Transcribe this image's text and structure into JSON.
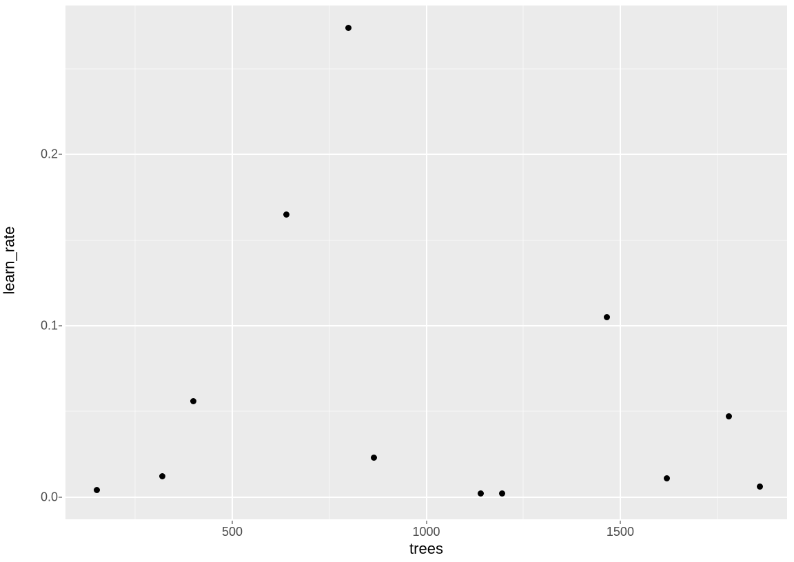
{
  "chart_data": {
    "type": "scatter",
    "xlabel": "trees",
    "ylabel": "learn_rate",
    "xlim": [
      70,
      1930
    ],
    "ylim": [
      -0.013,
      0.287
    ],
    "x_ticks": [
      500,
      1000,
      1500
    ],
    "y_ticks": [
      0.0,
      0.1,
      0.2
    ],
    "y_tick_labels": [
      "0.0",
      "0.1",
      "0.2"
    ],
    "x_minor": [
      250,
      750,
      1250,
      1750
    ],
    "y_minor": [
      0.05,
      0.15,
      0.25
    ],
    "series": [
      {
        "name": "points",
        "x": [
          150,
          320,
          400,
          640,
          800,
          865,
          1140,
          1195,
          1465,
          1620,
          1780,
          1860
        ],
        "y": [
          0.004,
          0.012,
          0.056,
          0.165,
          0.274,
          0.023,
          0.002,
          0.002,
          0.105,
          0.011,
          0.047,
          0.006
        ]
      }
    ]
  }
}
